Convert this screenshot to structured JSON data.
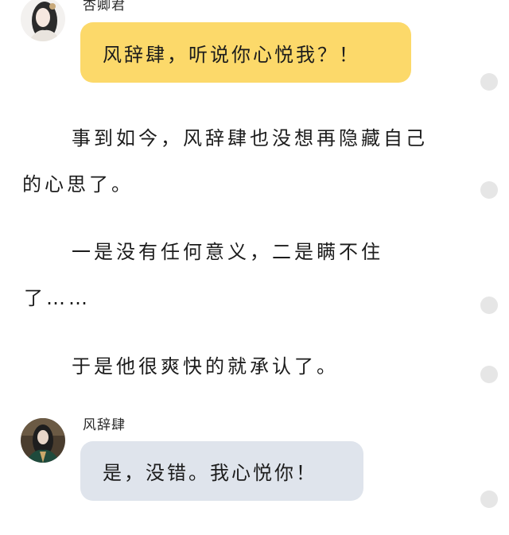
{
  "chat": {
    "messages": [
      {
        "speaker": "杏卿君",
        "text": "风辞肆，听说你心悦我？！",
        "bubble_color": "#fcd96a"
      },
      {
        "speaker": "风辞肆",
        "text": "是，没错。我心悦你！",
        "bubble_color": "#dfe4ec"
      }
    ]
  },
  "narration": {
    "lines": [
      "事到如今，风辞肆也没想再隐藏自己",
      "的心思了。",
      "一是没有任何意义，二是瞒不住",
      "了……",
      "于是他很爽快的就承认了。"
    ]
  },
  "colors": {
    "background": "#ffffff",
    "scroll_dot": "#e6e6e6"
  }
}
